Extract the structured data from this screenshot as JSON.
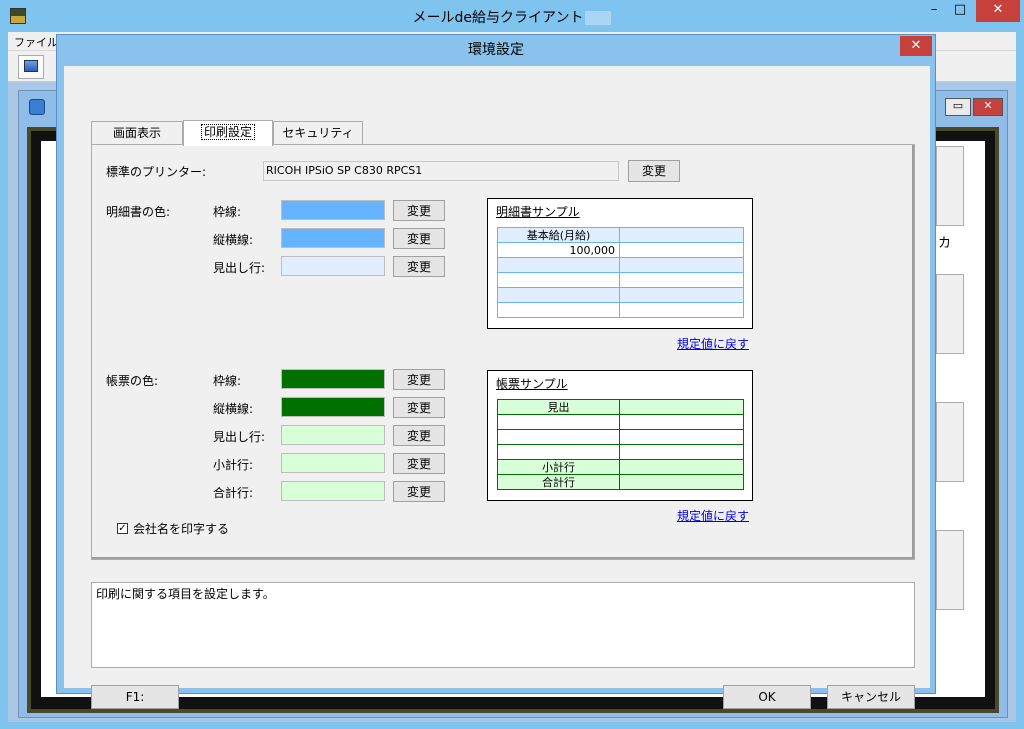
{
  "app": {
    "title": "メールde給与クライアント",
    "menu_file": "ファイル(F)"
  },
  "background": {
    "right_label": "カ"
  },
  "dialog": {
    "title": "環境設定",
    "close_label": "✕",
    "tabs": [
      {
        "label": "画面表示"
      },
      {
        "label": "印刷設定"
      },
      {
        "label": "セキュリティ"
      }
    ],
    "active_tab": "印刷設定",
    "printer": {
      "label": "標準のプリンター:",
      "value": "RICOH IPSiO SP C830 RPCS1",
      "change_label": "変更"
    },
    "meisai": {
      "section_label": "明細書の色:",
      "rows": [
        {
          "label": "枠線:",
          "color": "#66b3ff",
          "change_label": "変更"
        },
        {
          "label": "縦横線:",
          "color": "#66b3ff",
          "change_label": "変更"
        },
        {
          "label": "見出し行:",
          "color": "#e0eeff",
          "change_label": "変更"
        }
      ],
      "sample": {
        "title": "明細書サンプル",
        "header": "基本給(月給)",
        "value": "100,000"
      },
      "reset_label": "規定値に戻す"
    },
    "chohyo": {
      "section_label": "帳票の色:",
      "rows": [
        {
          "label": "枠線:",
          "color": "#007000",
          "change_label": "変更"
        },
        {
          "label": "縦横線:",
          "color": "#007000",
          "change_label": "変更"
        },
        {
          "label": "見出し行:",
          "color": "#d9ffd9",
          "change_label": "変更"
        },
        {
          "label": "小計行:",
          "color": "#d9ffd9",
          "change_label": "変更"
        },
        {
          "label": "合計行:",
          "color": "#d9ffd9",
          "change_label": "変更"
        }
      ],
      "sample": {
        "title": "帳票サンプル",
        "header": "見出",
        "subtotal": "小計行",
        "total": "合計行"
      },
      "reset_label": "規定値に戻す"
    },
    "print_company": {
      "checked": true,
      "check_mark": "✓",
      "label": "会社名を印字する"
    },
    "description": "印刷に関する項目を設定します。",
    "buttons": {
      "f1": "F1:",
      "ok": "OK",
      "cancel": "キャンセル"
    }
  }
}
